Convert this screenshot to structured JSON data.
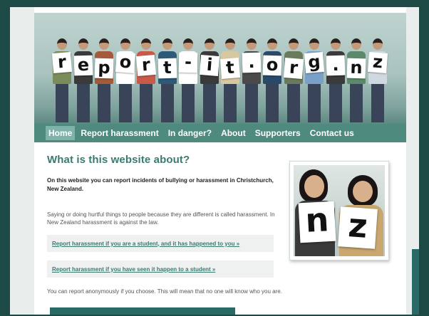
{
  "header": {
    "sign_letters": [
      "r",
      "e",
      "p",
      "o",
      "r",
      "t",
      "-",
      "i",
      "t",
      ".",
      "o",
      "r",
      "g",
      ".",
      "n",
      "z"
    ]
  },
  "nav": {
    "items": [
      {
        "label": "Home",
        "active": true
      },
      {
        "label": "Report harassment",
        "active": false
      },
      {
        "label": "In danger?",
        "active": false
      },
      {
        "label": "About",
        "active": false
      },
      {
        "label": "Supporters",
        "active": false
      },
      {
        "label": "Contact us",
        "active": false
      }
    ]
  },
  "main": {
    "title": "What is this website about?",
    "intro": "On this website you can report incidents of bullying or harassment in Christchurch, New Zealand.",
    "para1": "Saying or doing hurtful things to people because they are different is called harassment. In New Zealand harassment is against the law.",
    "cta1": "Report harassment if you are a student, and it has happened to you »",
    "cta2": "Report harassment if you have seen it happen to a student »",
    "para2": "You can report anonymously if you choose. This will mean that no one will know who you are."
  },
  "photo": {
    "sign_left": "n",
    "sign_right": "z"
  },
  "colors": {
    "nav_bg": "#4f8a7f",
    "nav_active": "#7fb3a9",
    "accent": "#3b7a70",
    "frame_bg": "#1d4a44"
  }
}
